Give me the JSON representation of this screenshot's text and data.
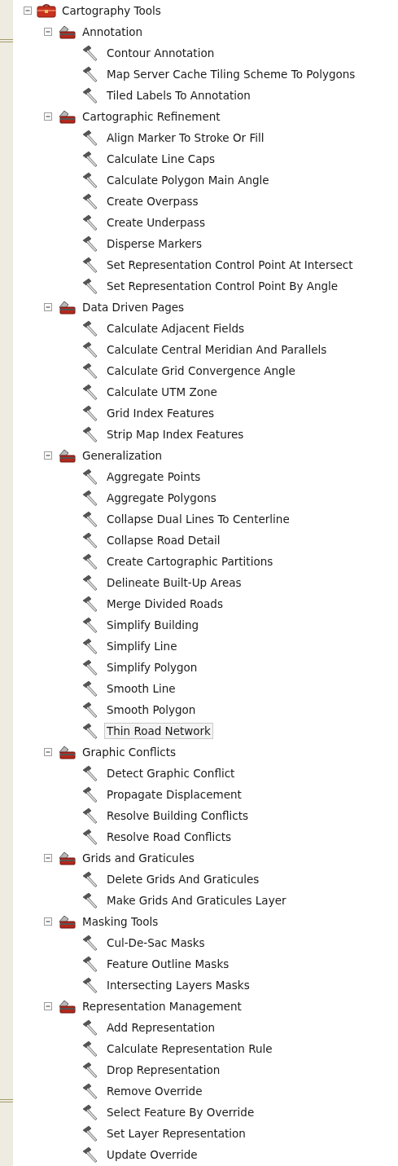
{
  "tree": {
    "kind": "toolbox",
    "label": "Cartography Tools",
    "expanded": true,
    "children": [
      {
        "kind": "toolset",
        "label": "Annotation",
        "expanded": true,
        "children": [
          {
            "kind": "tool",
            "label": "Contour Annotation",
            "selected": false
          },
          {
            "kind": "tool",
            "label": "Map Server Cache Tiling Scheme To Polygons",
            "selected": false
          },
          {
            "kind": "tool",
            "label": "Tiled Labels To Annotation",
            "selected": false
          }
        ]
      },
      {
        "kind": "toolset",
        "label": "Cartographic Refinement",
        "expanded": true,
        "children": [
          {
            "kind": "tool",
            "label": "Align Marker To Stroke Or Fill",
            "selected": false
          },
          {
            "kind": "tool",
            "label": "Calculate Line Caps",
            "selected": false
          },
          {
            "kind": "tool",
            "label": "Calculate Polygon Main Angle",
            "selected": false
          },
          {
            "kind": "tool",
            "label": "Create Overpass",
            "selected": false
          },
          {
            "kind": "tool",
            "label": "Create Underpass",
            "selected": false
          },
          {
            "kind": "tool",
            "label": "Disperse Markers",
            "selected": false
          },
          {
            "kind": "tool",
            "label": "Set Representation Control Point At Intersect",
            "selected": false
          },
          {
            "kind": "tool",
            "label": "Set Representation Control Point By Angle",
            "selected": false
          }
        ]
      },
      {
        "kind": "toolset",
        "label": "Data Driven Pages",
        "expanded": true,
        "children": [
          {
            "kind": "tool",
            "label": "Calculate Adjacent Fields",
            "selected": false
          },
          {
            "kind": "tool",
            "label": "Calculate Central Meridian And Parallels",
            "selected": false
          },
          {
            "kind": "tool",
            "label": "Calculate Grid Convergence Angle",
            "selected": false
          },
          {
            "kind": "tool",
            "label": "Calculate UTM Zone",
            "selected": false
          },
          {
            "kind": "tool",
            "label": "Grid Index Features",
            "selected": false
          },
          {
            "kind": "tool",
            "label": "Strip Map Index Features",
            "selected": false
          }
        ]
      },
      {
        "kind": "toolset",
        "label": "Generalization",
        "expanded": true,
        "children": [
          {
            "kind": "tool",
            "label": "Aggregate Points",
            "selected": false
          },
          {
            "kind": "tool",
            "label": "Aggregate Polygons",
            "selected": false
          },
          {
            "kind": "tool",
            "label": "Collapse Dual Lines To Centerline",
            "selected": false
          },
          {
            "kind": "tool",
            "label": "Collapse Road Detail",
            "selected": false
          },
          {
            "kind": "tool",
            "label": "Create Cartographic Partitions",
            "selected": false
          },
          {
            "kind": "tool",
            "label": "Delineate Built-Up Areas",
            "selected": false
          },
          {
            "kind": "tool",
            "label": "Merge Divided Roads",
            "selected": false
          },
          {
            "kind": "tool",
            "label": "Simplify Building",
            "selected": false
          },
          {
            "kind": "tool",
            "label": "Simplify Line",
            "selected": false
          },
          {
            "kind": "tool",
            "label": "Simplify Polygon",
            "selected": false
          },
          {
            "kind": "tool",
            "label": "Smooth Line",
            "selected": false
          },
          {
            "kind": "tool",
            "label": "Smooth Polygon",
            "selected": false
          },
          {
            "kind": "tool",
            "label": "Thin Road Network",
            "selected": true
          }
        ]
      },
      {
        "kind": "toolset",
        "label": "Graphic Conflicts",
        "expanded": true,
        "children": [
          {
            "kind": "tool",
            "label": "Detect Graphic Conflict",
            "selected": false
          },
          {
            "kind": "tool",
            "label": "Propagate Displacement",
            "selected": false
          },
          {
            "kind": "tool",
            "label": "Resolve Building Conflicts",
            "selected": false
          },
          {
            "kind": "tool",
            "label": "Resolve Road Conflicts",
            "selected": false
          }
        ]
      },
      {
        "kind": "toolset",
        "label": "Grids and Graticules",
        "expanded": true,
        "children": [
          {
            "kind": "tool",
            "label": "Delete Grids And Graticules",
            "selected": false
          },
          {
            "kind": "tool",
            "label": "Make Grids And Graticules Layer",
            "selected": false
          }
        ]
      },
      {
        "kind": "toolset",
        "label": "Masking Tools",
        "expanded": true,
        "children": [
          {
            "kind": "tool",
            "label": "Cul-De-Sac Masks",
            "selected": false
          },
          {
            "kind": "tool",
            "label": "Feature Outline Masks",
            "selected": false
          },
          {
            "kind": "tool",
            "label": "Intersecting Layers Masks",
            "selected": false
          }
        ]
      },
      {
        "kind": "toolset",
        "label": "Representation Management",
        "expanded": true,
        "children": [
          {
            "kind": "tool",
            "label": "Add Representation",
            "selected": false
          },
          {
            "kind": "tool",
            "label": "Calculate Representation Rule",
            "selected": false
          },
          {
            "kind": "tool",
            "label": "Drop Representation",
            "selected": false
          },
          {
            "kind": "tool",
            "label": "Remove Override",
            "selected": false
          },
          {
            "kind": "tool",
            "label": "Select Feature By Override",
            "selected": false
          },
          {
            "kind": "tool",
            "label": "Set Layer Representation",
            "selected": false
          },
          {
            "kind": "tool",
            "label": "Update Override",
            "selected": false
          }
        ]
      }
    ]
  }
}
